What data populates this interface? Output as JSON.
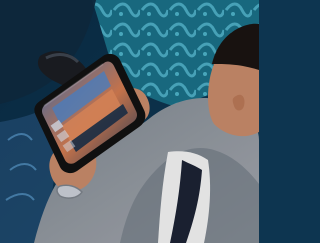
{
  "scene": {
    "subject": "photo",
    "colors": {
      "teal_carpet": "#1a6f86",
      "seat_fabric": "#0f2a3f",
      "suit": "#8a8f97",
      "shirt": "#f1f1f1",
      "tie": "#1c2233",
      "skin": "#c68a6a",
      "tablet_bezel": "#121212"
    }
  }
}
